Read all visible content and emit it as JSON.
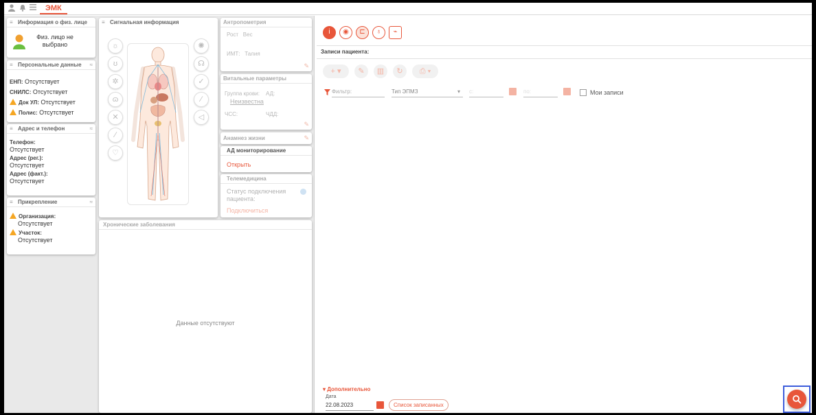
{
  "topbar": {
    "icons": [
      "user-icon",
      "bell-icon",
      "menu-icon"
    ],
    "tab_label": "ЭМК"
  },
  "person_card": {
    "title": "Информация о физ. лице",
    "placeholder_line1": "Физ. лицо не",
    "placeholder_line2": "выбрано"
  },
  "personal_data": {
    "title": "Персональные данные",
    "rows": [
      {
        "label": "ЕНП:",
        "value": "Отсутствует",
        "warning": false
      },
      {
        "label": "СНИЛС:",
        "value": "Отсутствует",
        "warning": false
      },
      {
        "label": "Док УЛ:",
        "value": "Отсутствует",
        "warning": true
      },
      {
        "label": "Полис:",
        "value": "Отсутствует",
        "warning": true
      }
    ]
  },
  "address_phone": {
    "title": "Адрес и телефон",
    "phone_label": "Телефон:",
    "phone_value": "Отсутствует",
    "addr_reg_label": "Адрес (рег.):",
    "addr_reg_value": "Отсутствует",
    "addr_fact_label": "Адрес (факт.):",
    "addr_fact_value": "Отсутствует"
  },
  "attachment": {
    "title": "Прикрепление",
    "org_label": "Организация:",
    "org_value": "Отсутствует",
    "district_label": "Участок:",
    "district_value": "Отсутствует"
  },
  "signal_info": {
    "title": "Сигнальная информация",
    "left_icons": [
      "sun-icon",
      "stethoscope-icon",
      "virus-icon",
      "lungs-icon",
      "bandage-icon",
      "syringe-icon",
      "heart-pulse-icon"
    ],
    "right_icons": [
      "allergy-icon",
      "pregnancy-icon",
      "check-circle-icon",
      "pill-icon",
      "capsule-icon"
    ]
  },
  "anthropometry": {
    "title": "Антропометрия",
    "height_label": "Рост",
    "weight_label": "Вес",
    "bmi_label": "ИМТ:",
    "waist_label": "Талия"
  },
  "vitals": {
    "title": "Витальные параметры",
    "blood_group_label": "Группа крови:",
    "bp_label": "АД:",
    "blood_group_value": "Неизвестна",
    "hr_label": "ЧСС:",
    "rr_label": "ЧДД:"
  },
  "life_anamnesis": {
    "title": "Анамнез жизни"
  },
  "bp_monitoring": {
    "title": "АД мониторирование",
    "open_link": "Открыть"
  },
  "telemedicine": {
    "title": "Телемедицина",
    "status_line1": "Статус подключения",
    "status_line2": "пациента:",
    "connect_link": "Подключиться"
  },
  "chronic": {
    "title": "Хронические заболевания",
    "empty_text": "Данные отсутствуют"
  },
  "records": {
    "tool_icons": [
      "person-info-icon",
      "eye-icon",
      "hierarchy-icon",
      "microscope-icon",
      "chart-icon"
    ],
    "title": "Записи пациента:",
    "actions": [
      "plus-dropdown-icon",
      "pencil-icon",
      "trash-icon",
      "refresh-icon",
      "print-dropdown-icon"
    ],
    "filter_placeholder": "Фильтр:",
    "type_placeholder": "Тип ЭПМЗ",
    "from_placeholder": "с:",
    "to_placeholder": "по:",
    "my_records_label": "Мои записи",
    "extra_toggle": "Дополнительно",
    "date_label": "Дата",
    "date_value": "22.08.2023",
    "list_button": "Список записанных"
  },
  "colors": {
    "accent": "#e8563a",
    "accent_faint": "#f4b3a3",
    "panel_bg": "#e9e9e9",
    "warning": "#f5a623"
  },
  "fab_icon": "search-icon"
}
